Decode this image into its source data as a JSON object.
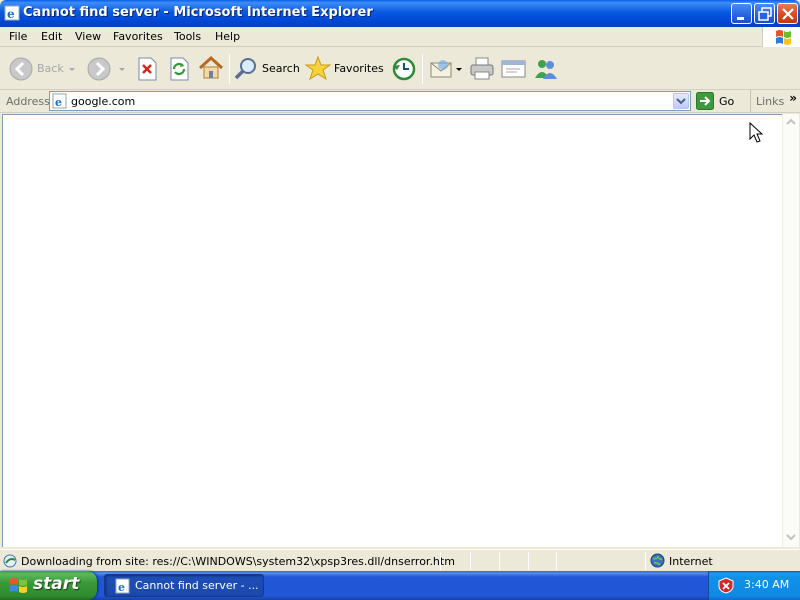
{
  "window": {
    "title": "Cannot find server - Microsoft Internet Explorer"
  },
  "menu": {
    "items": [
      "File",
      "Edit",
      "View",
      "Favorites",
      "Tools",
      "Help"
    ]
  },
  "toolbar": {
    "back_label": "Back",
    "search_label": "Search",
    "favorites_label": "Favorites"
  },
  "address": {
    "label": "Address",
    "value": "google.com",
    "go_label": "Go",
    "links_label": "Links",
    "links_chevron": "»"
  },
  "status": {
    "text": "Downloading from site: res://C:\\WINDOWS\\system32\\xpsp3res.dll/dnserror.htm",
    "zone": "Internet"
  },
  "taskbar": {
    "start_label": "start",
    "task_label": "Cannot find server - ...",
    "clock": "3:40 AM"
  },
  "colors": {
    "titlebar": "#0054e3",
    "taskbar": "#2157d7",
    "start_green": "#3a9a3a",
    "chrome": "#ece9d8"
  }
}
